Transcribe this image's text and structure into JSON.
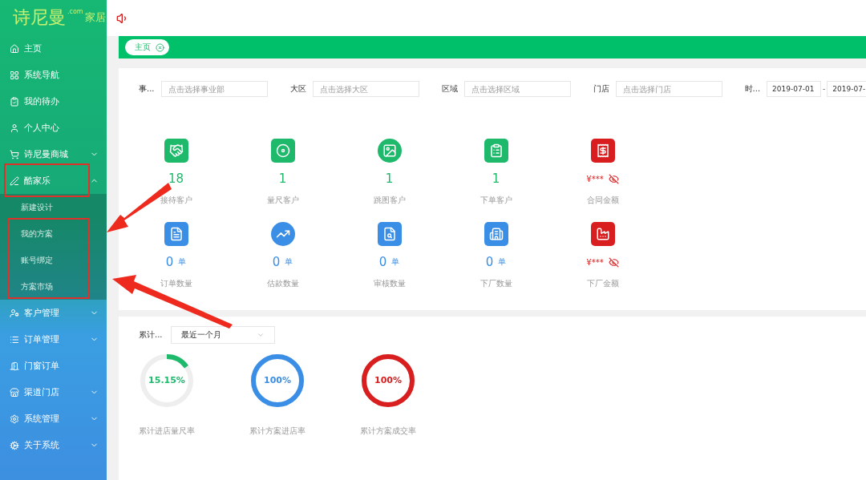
{
  "logo": {
    "brand": "诗尼曼",
    "domain": ".com",
    "suffix": "家居"
  },
  "sidebar": {
    "items": [
      {
        "label": "主页"
      },
      {
        "label": "系统导航"
      },
      {
        "label": "我的待办"
      },
      {
        "label": "个人中心"
      },
      {
        "label": "诗尼曼商城",
        "expanded": false
      },
      {
        "label": "酷家乐",
        "expanded": true,
        "children": [
          {
            "label": "新建设计"
          },
          {
            "label": "我的方案"
          },
          {
            "label": "账号绑定"
          },
          {
            "label": "方案市场"
          }
        ]
      },
      {
        "label": "客户管理",
        "expanded": false
      },
      {
        "label": "订单管理",
        "expanded": false
      },
      {
        "label": "门窗订单"
      },
      {
        "label": "渠道门店",
        "expanded": false
      },
      {
        "label": "系统管理",
        "expanded": false
      },
      {
        "label": "关于系统",
        "expanded": false
      }
    ]
  },
  "tabs": [
    {
      "label": "主页",
      "selected": true
    }
  ],
  "filters": [
    {
      "label": "事...",
      "placeholder": "点击选择事业部"
    },
    {
      "label": "大区",
      "placeholder": "点击选择大区"
    },
    {
      "label": "区域",
      "placeholder": "点击选择区域"
    },
    {
      "label": "门店",
      "placeholder": "点击选择门店"
    }
  ],
  "date_filter": {
    "label": "时...",
    "start": "2019-07-01",
    "separator": "-",
    "end": "2019-07-"
  },
  "stats": [
    {
      "value": "18",
      "label": "接待客户",
      "color": "#1fb96c",
      "kind": "count"
    },
    {
      "value": "1",
      "label": "量尺客户",
      "color": "#1fb96c",
      "kind": "count"
    },
    {
      "value": "1",
      "label": "跳图客户",
      "color": "#1fb96c",
      "kind": "count"
    },
    {
      "value": "1",
      "label": "下单客户",
      "color": "#1fb96c",
      "kind": "count"
    },
    {
      "value": "¥***",
      "label": "合同金额",
      "color": "#d81e1e",
      "kind": "hidden"
    },
    {
      "value": "0",
      "unit": "单",
      "label": "订单数量",
      "color": "#3a8ee6",
      "kind": "count"
    },
    {
      "value": "0",
      "unit": "单",
      "label": "估款数量",
      "color": "#3a8ee6",
      "kind": "count"
    },
    {
      "value": "0",
      "unit": "单",
      "label": "审核数量",
      "color": "#3a8ee6",
      "kind": "count"
    },
    {
      "value": "0",
      "unit": "单",
      "label": "下厂数量",
      "color": "#3a8ee6",
      "kind": "count"
    },
    {
      "value": "¥***",
      "label": "下厂金额",
      "color": "#d81e1e",
      "kind": "hidden"
    }
  ],
  "period": {
    "label": "累计...",
    "value": "最近一个月"
  },
  "rates": [
    {
      "value": "15.15%",
      "label": "累计进店量尺率",
      "level": 0.1515,
      "color": "#1fb96c"
    },
    {
      "value": "100%",
      "label": "累计方案进店率",
      "level": 1,
      "color": "#3a8ee6"
    },
    {
      "value": "100%",
      "label": "累计方案成交率",
      "level": 1,
      "color": "#d81e1e"
    }
  ]
}
